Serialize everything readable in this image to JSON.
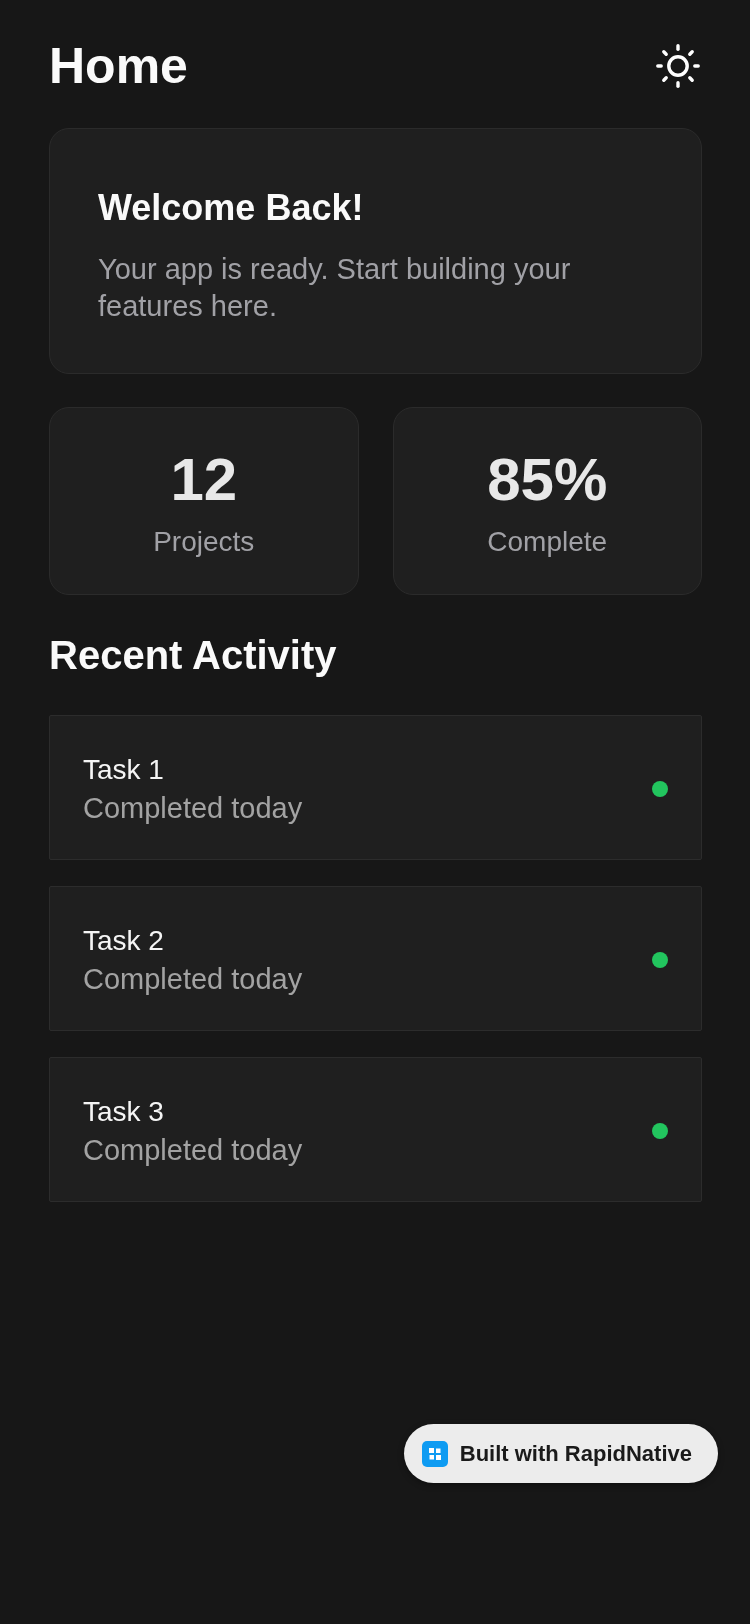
{
  "header": {
    "title": "Home"
  },
  "welcome_card": {
    "title": "Welcome Back!",
    "description": "Your app is ready. Start building your features here."
  },
  "stats": [
    {
      "value": "12",
      "label": "Projects"
    },
    {
      "value": "85%",
      "label": "Complete"
    }
  ],
  "recent_activity": {
    "title": "Recent Activity",
    "items": [
      {
        "title": "Task 1",
        "subtitle": "Completed today",
        "color": "#22c55e"
      },
      {
        "title": "Task 2",
        "subtitle": "Completed today",
        "color": "#22c55e"
      },
      {
        "title": "Task 3",
        "subtitle": "Completed today",
        "color": "#22c55e"
      }
    ]
  },
  "badge": {
    "label": "Built with RapidNative"
  }
}
